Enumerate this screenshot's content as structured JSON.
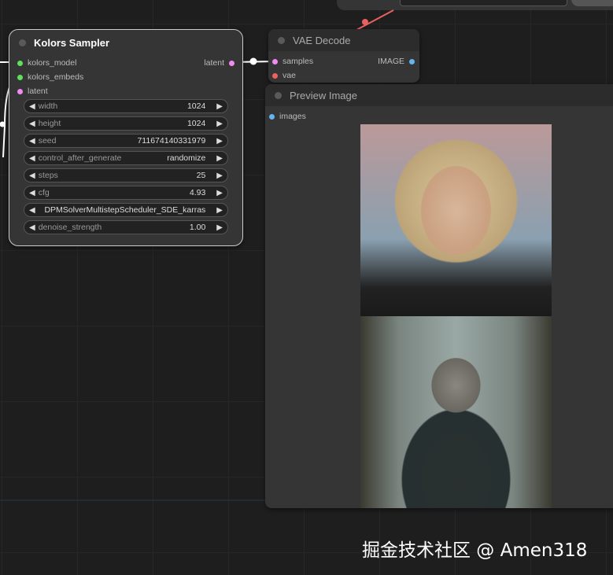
{
  "sampler": {
    "title": "Kolors Sampler",
    "inputs": [
      "kolors_model",
      "kolors_embeds",
      "latent"
    ],
    "output": "latent",
    "widgets": [
      {
        "label": "width",
        "value": "1024"
      },
      {
        "label": "height",
        "value": "1024"
      },
      {
        "label": "seed",
        "value": "711674140331979"
      },
      {
        "label": "control_after_generate",
        "value": "randomize"
      },
      {
        "label": "steps",
        "value": "25"
      },
      {
        "label": "cfg",
        "value": "4.93"
      },
      {
        "label": "",
        "value": "DPMSolverMultistepScheduler_SDE_karras"
      },
      {
        "label": "denoise_strength",
        "value": "1.00"
      }
    ]
  },
  "vae": {
    "title": "VAE Decode",
    "inputs": [
      "samples",
      "vae"
    ],
    "output": "IMAGE"
  },
  "preview": {
    "title": "Preview Image",
    "input": "images"
  },
  "watermark": "掘金技术社区 @ Amen318",
  "colors": {
    "model": "#5ee05e",
    "latent": "#f08cf0",
    "vae": "#f06060",
    "image": "#64b4f0",
    "link_vae": "#e86060"
  }
}
